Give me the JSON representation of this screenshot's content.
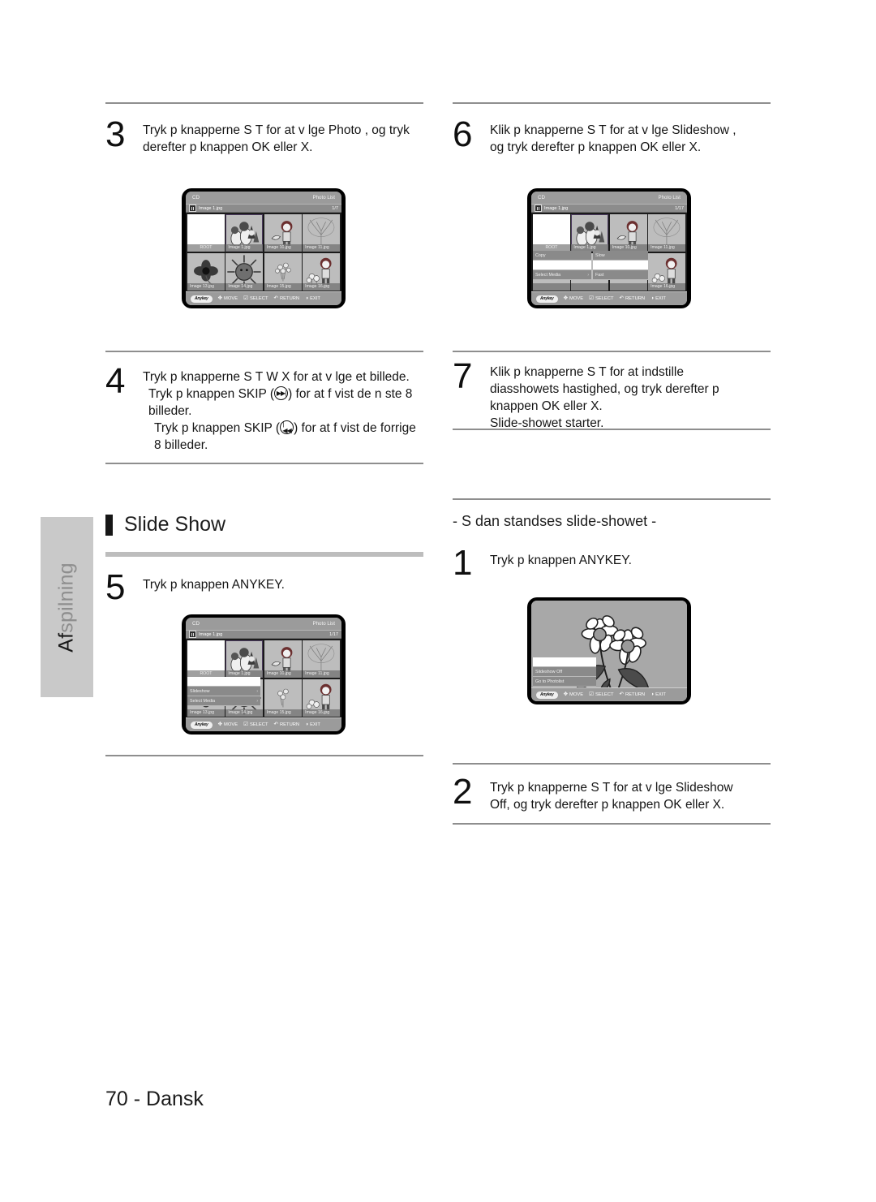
{
  "sidebar": {
    "label_bold": "Af",
    "label_light": "spilning"
  },
  "footer": {
    "page": "70 - Dansk"
  },
  "steps": {
    "s3": {
      "num": "3",
      "line1": "Tryk p  knapperne  S T  for at v lge  Photo , og tryk",
      "line2": "derefter p  knappen  OK eller  X."
    },
    "s4": {
      "num": "4",
      "line1": "Tryk p  knapperne  S T W X for at v lge et billede.",
      "line2a": "Tryk p  knappen  SKIP  (",
      "line2b": ") for at f  vist de n ste 8",
      "line3": "billeder.",
      "line4a": "Tryk p  knappen  SKIP  (",
      "line4b": ") for at f  vist de forrige",
      "line5": "8 billeder."
    },
    "s5": {
      "num": "5",
      "line1": "Tryk p  knappen  ANYKEY."
    },
    "s6": {
      "num": "6",
      "line1": "Klik p  knapperne  S T for at v lge  Slideshow ,",
      "line2": "og tryk derefter p  knappen  OK eller  X."
    },
    "s7": {
      "num": "7",
      "line1": "Klik p  knapperne  S T for at indstille",
      "line2": "diasshowets hastighed, og tryk derefter p",
      "line3": "knappen OK eller  X.",
      "line4": "Slide-showet starter."
    },
    "stop1": {
      "num": "1",
      "line1": "Tryk p  knappen  ANYKEY."
    },
    "stop2": {
      "num": "2",
      "line1": "Tryk p  knapperne  S T for at v lge  Slideshow",
      "line2": "Off, og tryk derefter p  knappen  OK eller  X."
    }
  },
  "section": {
    "slide_show_title": "Slide Show",
    "stop_title": "- S dan standses slide-showet -"
  },
  "icons": {
    "skip_next": "▶▶|",
    "skip_prev": "|◀◀"
  },
  "tv_common": {
    "source": "CD",
    "screen_title": "Photo List",
    "file_name": "Image 1.jpg",
    "bottom_bar": {
      "anykey": "Anykey",
      "move": "MOVE",
      "select": "SELECT",
      "return": "RETURN",
      "exit": "EXIT",
      "move_glyph": "✥",
      "select_glyph": "☑",
      "return_glyph": "↶",
      "exit_glyph": "◑"
    }
  },
  "tv_step3": {
    "counter": "1/7",
    "thumbs": [
      {
        "caption": "ROOT",
        "art": "root",
        "selected": false
      },
      {
        "caption": "Image 1.jpg",
        "art": "gnomes",
        "selected": true
      },
      {
        "caption": "Image 10.jpg",
        "art": "girl-dog",
        "selected": false
      },
      {
        "caption": "Image 11.jpg",
        "art": "tree",
        "selected": false
      },
      {
        "caption": "Image 13.jpg",
        "art": "flower-dark",
        "selected": false
      },
      {
        "caption": "Image 14.jpg",
        "art": "sun",
        "selected": false
      },
      {
        "caption": "Image 15.jpg",
        "art": "small-flowers",
        "selected": false
      },
      {
        "caption": "Image 16.jpg",
        "art": "girl-flowers",
        "selected": false
      }
    ]
  },
  "tv_step5": {
    "counter": "1/17",
    "thumbs": [
      {
        "caption": "ROOT",
        "art": "root",
        "selected": false
      },
      {
        "caption": "Image 1.jpg",
        "art": "gnomes",
        "selected": true
      },
      {
        "caption": "Image 10.jpg",
        "art": "girl-dog",
        "selected": false
      },
      {
        "caption": "Image 11.jpg",
        "art": "tree",
        "selected": false
      },
      {
        "caption": "Image 13.jpg",
        "art": "flower-dark",
        "selected": false
      },
      {
        "caption": "Image 14.jpg",
        "art": "sun",
        "selected": false
      },
      {
        "caption": "Image 15.jpg",
        "art": "small-flowers",
        "selected": false
      },
      {
        "caption": "Image 16.jpg",
        "art": "girl-flowers",
        "selected": false
      }
    ],
    "menu": [
      {
        "label": "",
        "arrow": "",
        "blank": true
      },
      {
        "label": "Slideshow",
        "arrow": "›",
        "blank": false
      },
      {
        "label": "Select Media",
        "arrow": "›",
        "blank": false
      }
    ]
  },
  "tv_step6": {
    "counter": "1/17",
    "thumbs": [
      {
        "caption": "ROOT",
        "art": "root",
        "selected": false
      },
      {
        "caption": "Image 1.jpg",
        "art": "gnomes",
        "selected": true
      },
      {
        "caption": "Image 10.jpg",
        "art": "girl-dog",
        "selected": false
      },
      {
        "caption": "Image 11.jpg",
        "art": "tree",
        "selected": false
      },
      {
        "caption": "",
        "art": "flower-dark",
        "selected": false
      },
      {
        "caption": "",
        "art": "sun",
        "selected": false
      },
      {
        "caption": "",
        "art": "small-flowers",
        "selected": false
      },
      {
        "caption": "Image 16.jpg",
        "art": "girl-flowers",
        "selected": false
      }
    ],
    "menu_left": [
      {
        "label": "Copy",
        "arrow": "",
        "blank": false
      },
      {
        "label": "",
        "arrow": "",
        "blank": true
      },
      {
        "label": "Select Media",
        "arrow": "›",
        "blank": false
      }
    ],
    "menu_right": [
      {
        "label": "Slow",
        "arrow": "",
        "blank": false
      },
      {
        "label": "",
        "arrow": "",
        "blank": true
      },
      {
        "label": "Fast",
        "arrow": "",
        "blank": false
      }
    ]
  },
  "tv_stop1": {
    "menu": [
      {
        "label": "",
        "arrow": "",
        "blank": true
      },
      {
        "label": "Slideshow Off",
        "arrow": "",
        "blank": false
      },
      {
        "label": "Go to Photolist",
        "arrow": "",
        "blank": false
      }
    ]
  }
}
